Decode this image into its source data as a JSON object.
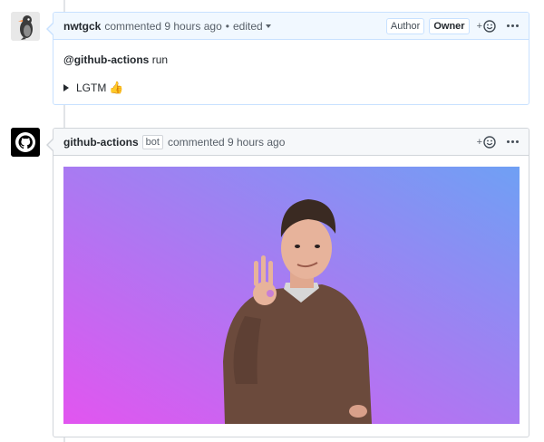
{
  "comments": [
    {
      "author": "nwtgck",
      "action": "commented 9 hours ago",
      "edited": "edited",
      "badges": [
        "Author",
        "Owner"
      ],
      "reaction_plus": "+",
      "body_mention": "@github-actions",
      "body_text": " run",
      "details_summary": "LGTM",
      "details_emoji": "👍"
    },
    {
      "author": "github-actions",
      "bot_label": "bot",
      "action": "commented 9 hours ago",
      "reaction_plus": "+",
      "image_desc_name": "reaction-gif"
    }
  ],
  "colors": {
    "gif_top_right": "#6fa0f4",
    "gif_bottom_left": "#e255f0",
    "header_blue": "#f1f8ff",
    "border_blue": "#c8e1ff"
  }
}
